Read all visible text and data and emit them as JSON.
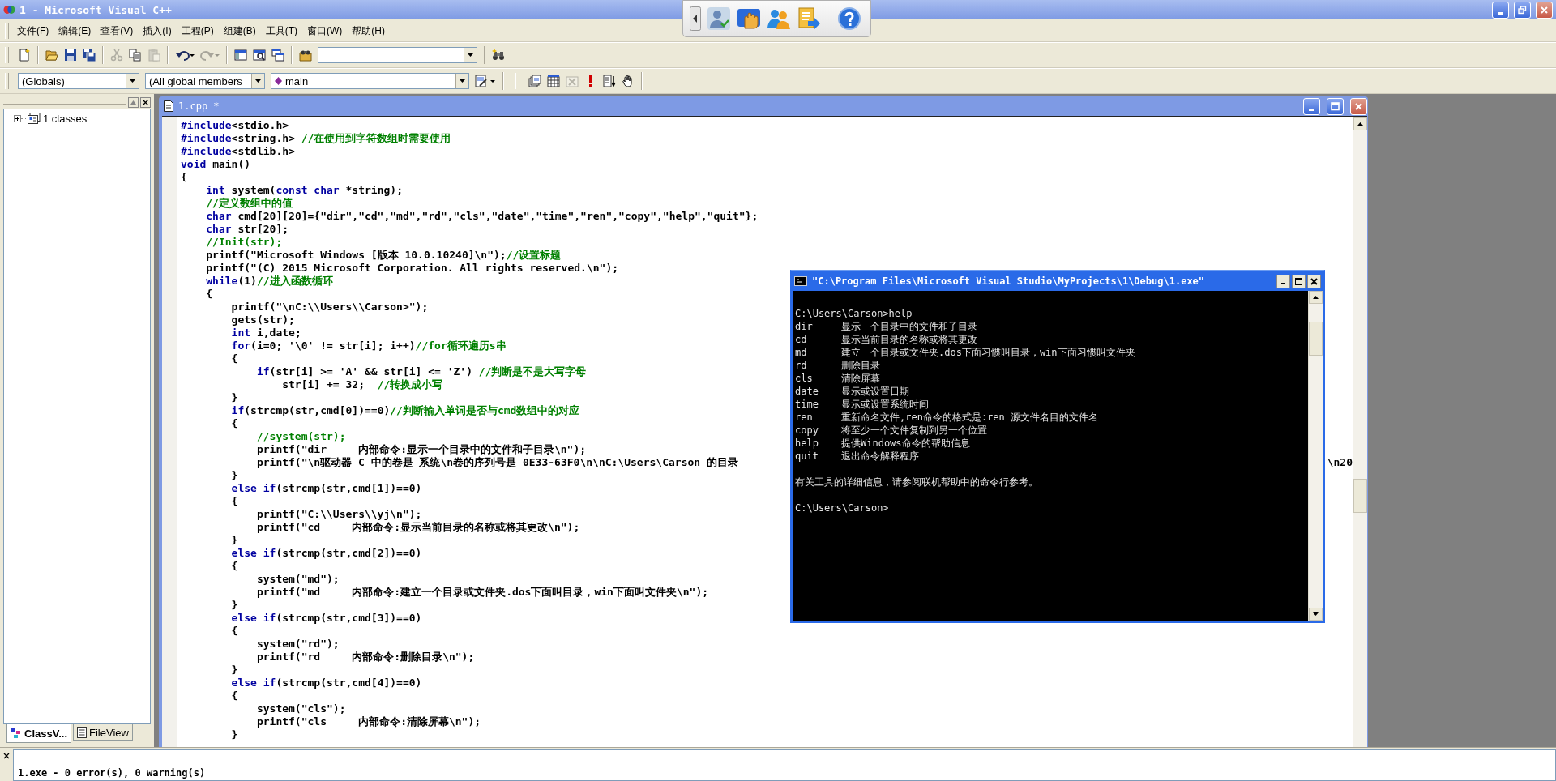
{
  "window": {
    "title": "1 - Microsoft Visual C++"
  },
  "menu": [
    {
      "label": "文件(F)"
    },
    {
      "label": "编辑(E)"
    },
    {
      "label": "查看(V)"
    },
    {
      "label": "插入(I)"
    },
    {
      "label": "工程(P)"
    },
    {
      "label": "组建(B)"
    },
    {
      "label": "工具(T)"
    },
    {
      "label": "窗口(W)"
    },
    {
      "label": "帮助(H)"
    }
  ],
  "standard_toolbar": [
    [
      {
        "kind": "new",
        "disabled": false
      }
    ],
    [
      {
        "kind": "open",
        "disabled": false
      },
      {
        "kind": "save",
        "disabled": false
      },
      {
        "kind": "save_all",
        "disabled": false
      }
    ],
    [
      {
        "kind": "cut",
        "disabled": true
      },
      {
        "kind": "copy",
        "disabled": false
      },
      {
        "kind": "paste",
        "disabled": true
      }
    ],
    [
      {
        "kind": "undo",
        "disabled": false
      },
      {
        "kind": "redo",
        "disabled": true
      }
    ],
    [
      {
        "kind": "workspace",
        "disabled": false
      },
      {
        "kind": "output",
        "disabled": false
      },
      {
        "kind": "window_list",
        "disabled": false
      }
    ],
    [
      {
        "kind": "find_in_files",
        "disabled": false
      },
      {
        "kind": "search_combo",
        "disabled": false
      }
    ],
    [
      {
        "kind": "find",
        "disabled": false
      }
    ]
  ],
  "wizard_bar": {
    "class": "(Globals)",
    "filter": "(All global members",
    "member": "main"
  },
  "build_toolbar": [
    {
      "kind": "compile",
      "disabled": false
    },
    {
      "kind": "build",
      "disabled": false
    },
    {
      "kind": "stop",
      "disabled": true
    },
    {
      "kind": "execute",
      "disabled": false
    },
    {
      "kind": "breakpoint",
      "disabled": false
    },
    {
      "kind": "go",
      "disabled": false
    }
  ],
  "workspace": {
    "tree": [
      {
        "label": "1 classes",
        "expanded": false
      }
    ],
    "tabs": [
      {
        "label": "ClassV...",
        "selected": true
      },
      {
        "label": "FileView",
        "selected": false
      }
    ]
  },
  "editor": {
    "title": "1.cpp *",
    "lines": [
      {
        "segments": [
          {
            "kind": "keyword",
            "text": "#include"
          },
          {
            "kind": "code",
            "text": "<stdio.h>"
          }
        ]
      },
      {
        "segments": [
          {
            "kind": "keyword",
            "text": "#include"
          },
          {
            "kind": "code",
            "text": "<string.h> "
          },
          {
            "kind": "comment",
            "text": "//在使用到字符数组时需要使用"
          }
        ]
      },
      {
        "segments": [
          {
            "kind": "keyword",
            "text": "#include"
          },
          {
            "kind": "code",
            "text": "<stdlib.h>"
          }
        ]
      },
      {
        "segments": [
          {
            "kind": "keyword",
            "text": "void"
          },
          {
            "kind": "code",
            "text": " main()"
          }
        ]
      },
      {
        "segments": [
          {
            "kind": "code",
            "text": "{"
          }
        ],
        "children": [
          {
            "segments": [
              {
                "kind": "keyword",
                "text": "int"
              },
              {
                "kind": "code",
                "text": " system("
              },
              {
                "kind": "keyword",
                "text": "const char"
              },
              {
                "kind": "code",
                "text": " *string);"
              }
            ]
          },
          {
            "segments": [
              {
                "kind": "comment",
                "text": "//定义数组中的值"
              }
            ]
          },
          {
            "segments": [
              {
                "kind": "keyword",
                "text": "char"
              },
              {
                "kind": "code",
                "text": " cmd[20][20]={\"dir\",\"cd\",\"md\",\"rd\",\"cls\",\"date\",\"time\",\"ren\",\"copy\",\"help\",\"quit\"};"
              }
            ]
          },
          {
            "segments": [
              {
                "kind": "keyword",
                "text": "char"
              },
              {
                "kind": "code",
                "text": " str[20];"
              }
            ]
          },
          {
            "segments": [
              {
                "kind": "comment",
                "text": "//Init(str);"
              }
            ]
          },
          {
            "segments": [
              {
                "kind": "code",
                "text": "printf(\"Microsoft Windows [版本 10.0.10240]\\n\");"
              },
              {
                "kind": "comment",
                "text": "//设置标题"
              }
            ]
          },
          {
            "segments": [
              {
                "kind": "code",
                "text": "printf(\"(C) 2015 Microsoft Corporation. All rights reserved.\\n\");"
              }
            ]
          },
          {
            "segments": [
              {
                "kind": "keyword",
                "text": "while"
              },
              {
                "kind": "code",
                "text": "(1)"
              },
              {
                "kind": "comment",
                "text": "//进入函数循环"
              }
            ]
          },
          {
            "segments": [
              {
                "kind": "code",
                "text": "{"
              }
            ],
            "children": [
              {
                "segments": [
                  {
                    "kind": "code",
                    "text": "printf(\"\\nC:\\\\Users\\\\Carson>\");"
                  }
                ]
              },
              {
                "segments": [
                  {
                    "kind": "code",
                    "text": "gets(str);"
                  }
                ]
              },
              {
                "segments": [
                  {
                    "kind": "keyword",
                    "text": "int"
                  },
                  {
                    "kind": "code",
                    "text": " i,date;"
                  }
                ]
              },
              {
                "segments": [
                  {
                    "kind": "keyword",
                    "text": "for"
                  },
                  {
                    "kind": "code",
                    "text": "(i=0; '\\0' != str[i]; i++)"
                  },
                  {
                    "kind": "comment",
                    "text": "//for循环遍历s串"
                  }
                ]
              },
              {
                "segments": [
                  {
                    "kind": "code",
                    "text": "{"
                  }
                ],
                "children": [
                  {
                    "segments": [
                      {
                        "kind": "keyword",
                        "text": "if"
                      },
                      {
                        "kind": "code",
                        "text": "(str[i] >= 'A' && str[i] <= 'Z') "
                      },
                      {
                        "kind": "comment",
                        "text": "//判断是不是大写字母"
                      }
                    ],
                    "children": [
                      {
                        "segments": [
                          {
                            "kind": "code",
                            "text": "str[i] += 32;  "
                          },
                          {
                            "kind": "comment",
                            "text": "//转换成小写"
                          }
                        ]
                      }
                    ]
                  }
                ]
              },
              {
                "segments": [
                  {
                    "kind": "code",
                    "text": "}"
                  }
                ]
              },
              {
                "segments": [
                  {
                    "kind": "keyword",
                    "text": "if"
                  },
                  {
                    "kind": "code",
                    "text": "(strcmp(str,cmd[0])==0)"
                  },
                  {
                    "kind": "comment",
                    "text": "//判断输入单词是否与cmd数组中的对应"
                  }
                ]
              },
              {
                "segments": [
                  {
                    "kind": "code",
                    "text": "{"
                  }
                ],
                "children": [
                  {
                    "segments": [
                      {
                        "kind": "comment",
                        "text": "//system(str);"
                      }
                    ]
                  },
                  {
                    "segments": [
                      {
                        "kind": "code",
                        "text": "printf(\"dir     内部命令:显示一个目录中的文件和子目录\\n\");"
                      }
                    ]
                  },
                  {
                    "segments": [
                      {
                        "kind": "code",
                        "text": "printf(\"\\n驱动器 C 中的卷是 系统\\n卷的序列号是 0E33-63F0\\n\\nC:\\Users\\Carson 的目录"
                      },
                      {
                        "kind": "tail",
                        "text": "\\n20"
                      }
                    ]
                  }
                ]
              },
              {
                "segments": [
                  {
                    "kind": "code",
                    "text": "}"
                  }
                ]
              },
              {
                "segments": [
                  {
                    "kind": "keyword",
                    "text": "else if"
                  },
                  {
                    "kind": "code",
                    "text": "(strcmp(str,cmd[1])==0)"
                  }
                ]
              },
              {
                "segments": [
                  {
                    "kind": "code",
                    "text": "{"
                  }
                ],
                "children": [
                  {
                    "segments": [
                      {
                        "kind": "code",
                        "text": "printf(\"C:\\\\Users\\\\yj\\n\");"
                      }
                    ]
                  },
                  {
                    "segments": [
                      {
                        "kind": "code",
                        "text": "printf(\"cd     内部命令:显示当前目录的名称或将其更改\\n\");"
                      }
                    ]
                  }
                ]
              },
              {
                "segments": [
                  {
                    "kind": "code",
                    "text": "}"
                  }
                ]
              },
              {
                "segments": [
                  {
                    "kind": "keyword",
                    "text": "else if"
                  },
                  {
                    "kind": "code",
                    "text": "(strcmp(str,cmd[2])==0)"
                  }
                ]
              },
              {
                "segments": [
                  {
                    "kind": "code",
                    "text": "{"
                  }
                ],
                "children": [
                  {
                    "segments": [
                      {
                        "kind": "code",
                        "text": "system(\"md\");"
                      }
                    ]
                  },
                  {
                    "segments": [
                      {
                        "kind": "code",
                        "text": "printf(\"md     内部命令:建立一个目录或文件夹.dos下面叫目录，win下面叫文件夹\\n\");"
                      }
                    ]
                  }
                ]
              },
              {
                "segments": [
                  {
                    "kind": "code",
                    "text": "}"
                  }
                ]
              },
              {
                "segments": [
                  {
                    "kind": "keyword",
                    "text": "else if"
                  },
                  {
                    "kind": "code",
                    "text": "(strcmp(str,cmd[3])==0)"
                  }
                ]
              },
              {
                "segments": [
                  {
                    "kind": "code",
                    "text": "{"
                  }
                ],
                "children": [
                  {
                    "segments": [
                      {
                        "kind": "code",
                        "text": "system(\"rd\");"
                      }
                    ]
                  },
                  {
                    "segments": [
                      {
                        "kind": "code",
                        "text": "printf(\"rd     内部命令:删除目录\\n\");"
                      }
                    ]
                  }
                ]
              },
              {
                "segments": [
                  {
                    "kind": "code",
                    "text": "}"
                  }
                ]
              },
              {
                "segments": [
                  {
                    "kind": "keyword",
                    "text": "else if"
                  },
                  {
                    "kind": "code",
                    "text": "(strcmp(str,cmd[4])==0)"
                  }
                ]
              },
              {
                "segments": [
                  {
                    "kind": "code",
                    "text": "{"
                  }
                ],
                "children": [
                  {
                    "segments": [
                      {
                        "kind": "code",
                        "text": "system(\"cls\");"
                      }
                    ]
                  },
                  {
                    "segments": [
                      {
                        "kind": "code",
                        "text": "printf(\"cls     内部命令:清除屏幕\\n\");"
                      }
                    ]
                  }
                ]
              },
              {
                "segments": [
                  {
                    "kind": "code",
                    "text": "}"
                  }
                ]
              }
            ]
          }
        ]
      }
    ]
  },
  "console": {
    "title": "\"C:\\Program Files\\Microsoft Visual Studio\\MyProjects\\1\\Debug\\1.exe\"",
    "command_line": "C:\\Users\\Carson>help",
    "help_entries": [
      {
        "command": "dir",
        "description": "显示一个目录中的文件和子目录"
      },
      {
        "command": "cd",
        "description": "显示当前目录的名称或将其更改"
      },
      {
        "command": "md",
        "description": "建立一个目录或文件夹.dos下面习惯叫目录，win下面习惯叫文件夹"
      },
      {
        "command": "rd",
        "description": "删除目录"
      },
      {
        "command": "cls",
        "description": "清除屏幕"
      },
      {
        "command": "date",
        "description": "显示或设置日期"
      },
      {
        "command": "time",
        "description": "显示或设置系统时间"
      },
      {
        "command": "ren",
        "description": "重新命名文件,ren命令的格式是:ren 源文件名目的文件名"
      },
      {
        "command": "copy",
        "description": "将至少一个文件复制到另一个位置"
      },
      {
        "command": "help",
        "description": "提供Windows命令的帮助信息"
      },
      {
        "command": "quit",
        "description": "退出命令解释程序"
      }
    ],
    "note": "有关工具的详细信息，请参阅联机帮助中的命令行参考。",
    "prompt": "C:\\Users\\Carson>"
  },
  "output": {
    "message": "1.exe - 0 error(s), 0 warning(s)"
  }
}
